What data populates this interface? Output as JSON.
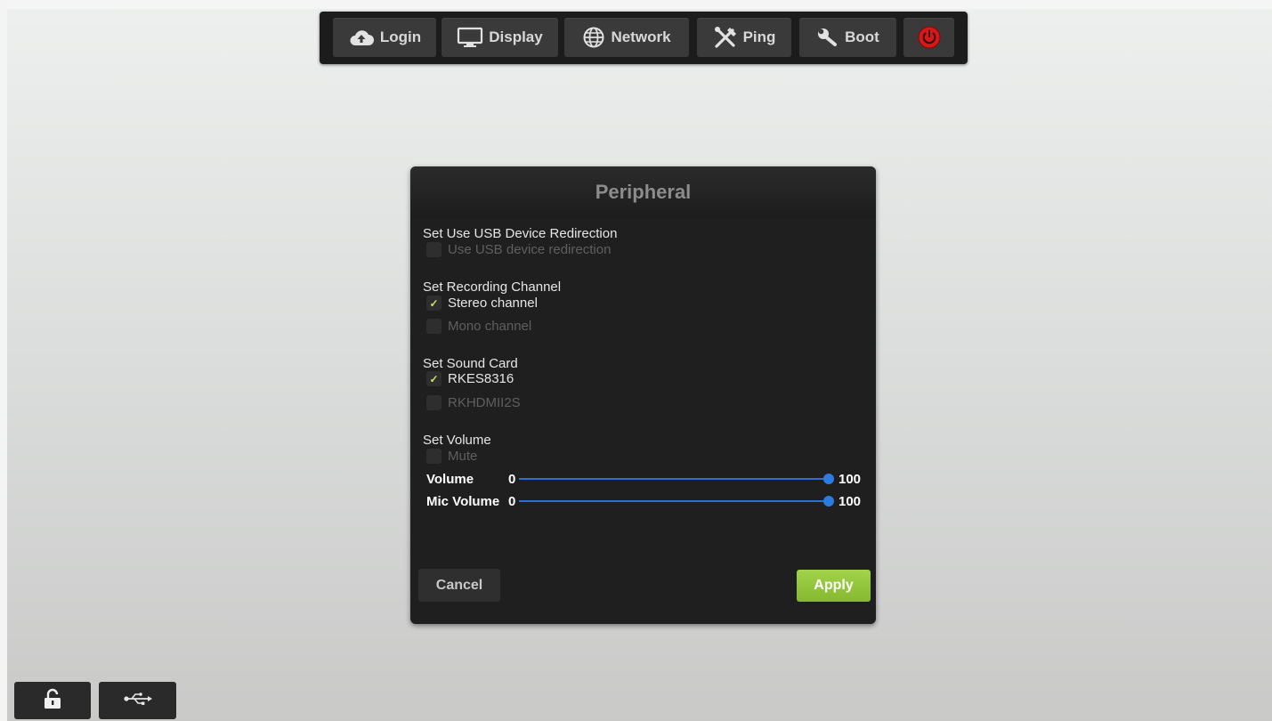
{
  "toolbar": {
    "items": [
      {
        "label": "Login",
        "icon": "cloud-upload-icon"
      },
      {
        "label": "Display",
        "icon": "monitor-icon"
      },
      {
        "label": "Network",
        "icon": "globe-icon"
      },
      {
        "label": "Ping",
        "icon": "tools-icon"
      },
      {
        "label": "Boot",
        "icon": "wrench-icon"
      },
      {
        "label": "",
        "icon": "power-icon"
      }
    ]
  },
  "dialog": {
    "title": "Peripheral",
    "sections": {
      "usb": {
        "title": "Set Use USB Device Redirection",
        "options": [
          {
            "label": "Use USB device redirection",
            "checked": false
          }
        ]
      },
      "recording": {
        "title": "Set Recording Channel",
        "options": [
          {
            "label": "Stereo channel",
            "checked": true
          },
          {
            "label": "Mono channel",
            "checked": false
          }
        ]
      },
      "sound_card": {
        "title": "Set Sound Card",
        "options": [
          {
            "label": "RKES8316",
            "checked": true
          },
          {
            "label": "RKHDMII2S",
            "checked": false
          }
        ]
      },
      "volume": {
        "title": "Set Volume",
        "mute_label": "Mute",
        "mute_checked": false,
        "sliders": [
          {
            "label": "Volume",
            "min": "0",
            "max": "100",
            "value": 100
          },
          {
            "label": "Mic Volume",
            "min": "0",
            "max": "100",
            "value": 100
          }
        ]
      }
    },
    "cancel_label": "Cancel",
    "apply_label": "Apply",
    "check_glyph": "✓"
  },
  "bottom": {
    "icons": [
      "unlock-icon",
      "usb-icon"
    ]
  },
  "colors": {
    "accent_blue": "#2e7be0",
    "apply_green": "#96c83c",
    "check_green": "#c9e26a"
  }
}
